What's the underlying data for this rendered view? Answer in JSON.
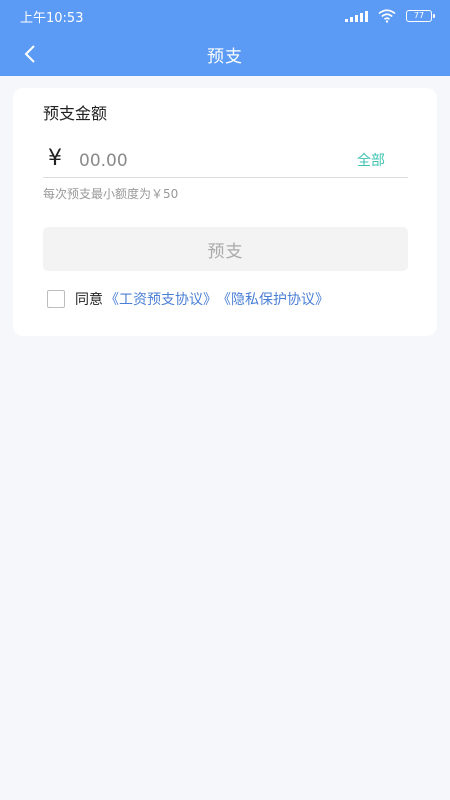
{
  "status_bar": {
    "time": "上午10:53",
    "battery": "77"
  },
  "navbar": {
    "title": "预支"
  },
  "form": {
    "label": "预支金额",
    "currency_symbol": "¥",
    "amount_placeholder": "00.00",
    "all_label": "全部",
    "hint": "每次预支最小额度为￥50",
    "submit_label": "预支",
    "agree_label": "同意",
    "agreement_link_1": "《工资预支协议》",
    "agreement_link_2": "《隐私保护协议》"
  },
  "icons": {
    "back": "chevron-left-icon",
    "signal": "signal-icon",
    "wifi": "wifi-icon",
    "battery": "battery-icon"
  },
  "colors": {
    "header": "#5c9bf5",
    "accent_link": "#4a7fd6",
    "all_link": "#3fc3b3",
    "background": "#f6f7fb"
  }
}
